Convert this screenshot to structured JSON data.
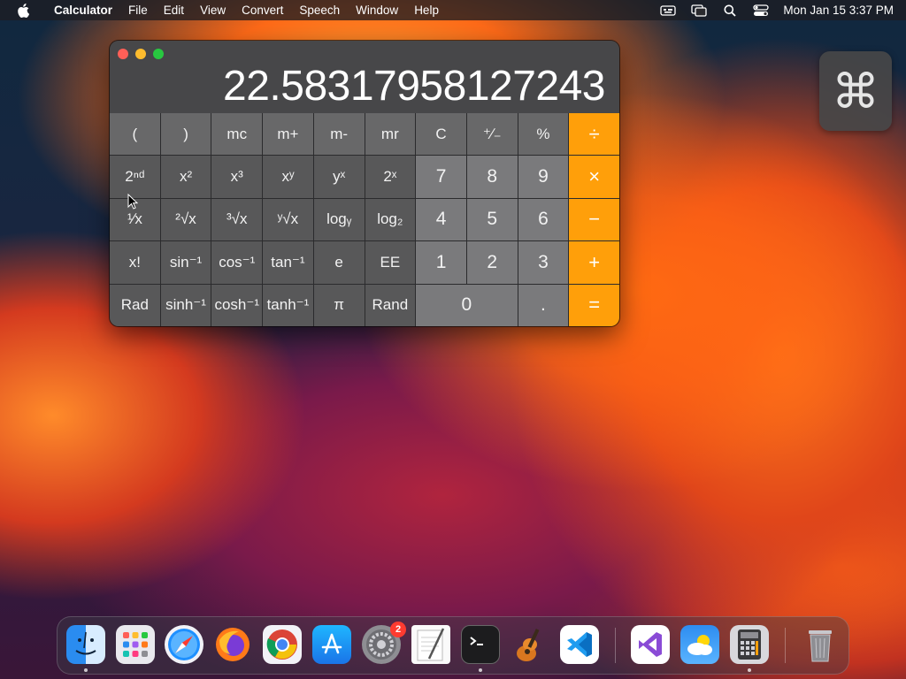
{
  "menubar": {
    "app_name": "Calculator",
    "menus": [
      "File",
      "Edit",
      "View",
      "Convert",
      "Speech",
      "Window",
      "Help"
    ],
    "clock": "Mon Jan 15  3:37 PM",
    "status_icons": [
      "keyboard-input-icon",
      "screen-mirroring-icon",
      "spotlight-search-icon",
      "control-center-icon"
    ]
  },
  "calculator": {
    "display": "22.58317958127243",
    "keys": [
      [
        "(",
        ")",
        "mc",
        "m+",
        "m-",
        "mr",
        "C",
        "⁺∕₋",
        "%",
        "÷"
      ],
      [
        "2ⁿᵈ",
        "x²",
        "x³",
        "xʸ",
        "yˣ",
        "2ˣ",
        "7",
        "8",
        "9",
        "×"
      ],
      [
        "¹∕x",
        "²√x",
        "³√x",
        "ʸ√x",
        "logᵧ",
        "log₂",
        "4",
        "5",
        "6",
        "−"
      ],
      [
        "x!",
        "sin⁻¹",
        "cos⁻¹",
        "tan⁻¹",
        "e",
        "EE",
        "1",
        "2",
        "3",
        "+"
      ],
      [
        "Rad",
        "sinh⁻¹",
        "cosh⁻¹",
        "tanh⁻¹",
        "π",
        "Rand",
        "0",
        ".",
        "="
      ]
    ]
  },
  "overlay": {
    "command_symbol": "⌘"
  },
  "dock": {
    "system_preferences_badge": "2",
    "apps": [
      "finder",
      "launchpad",
      "safari",
      "firefox",
      "chrome",
      "app-store",
      "system-preferences",
      "textedit",
      "terminal",
      "garageband",
      "vscode",
      "visual-studio",
      "weather",
      "calculator",
      "trash"
    ]
  },
  "colors": {
    "accent_operator": "#ff9f0a",
    "digit_key": "#7a7a7c",
    "function_key": "#585859",
    "display_bg": "#474749"
  }
}
